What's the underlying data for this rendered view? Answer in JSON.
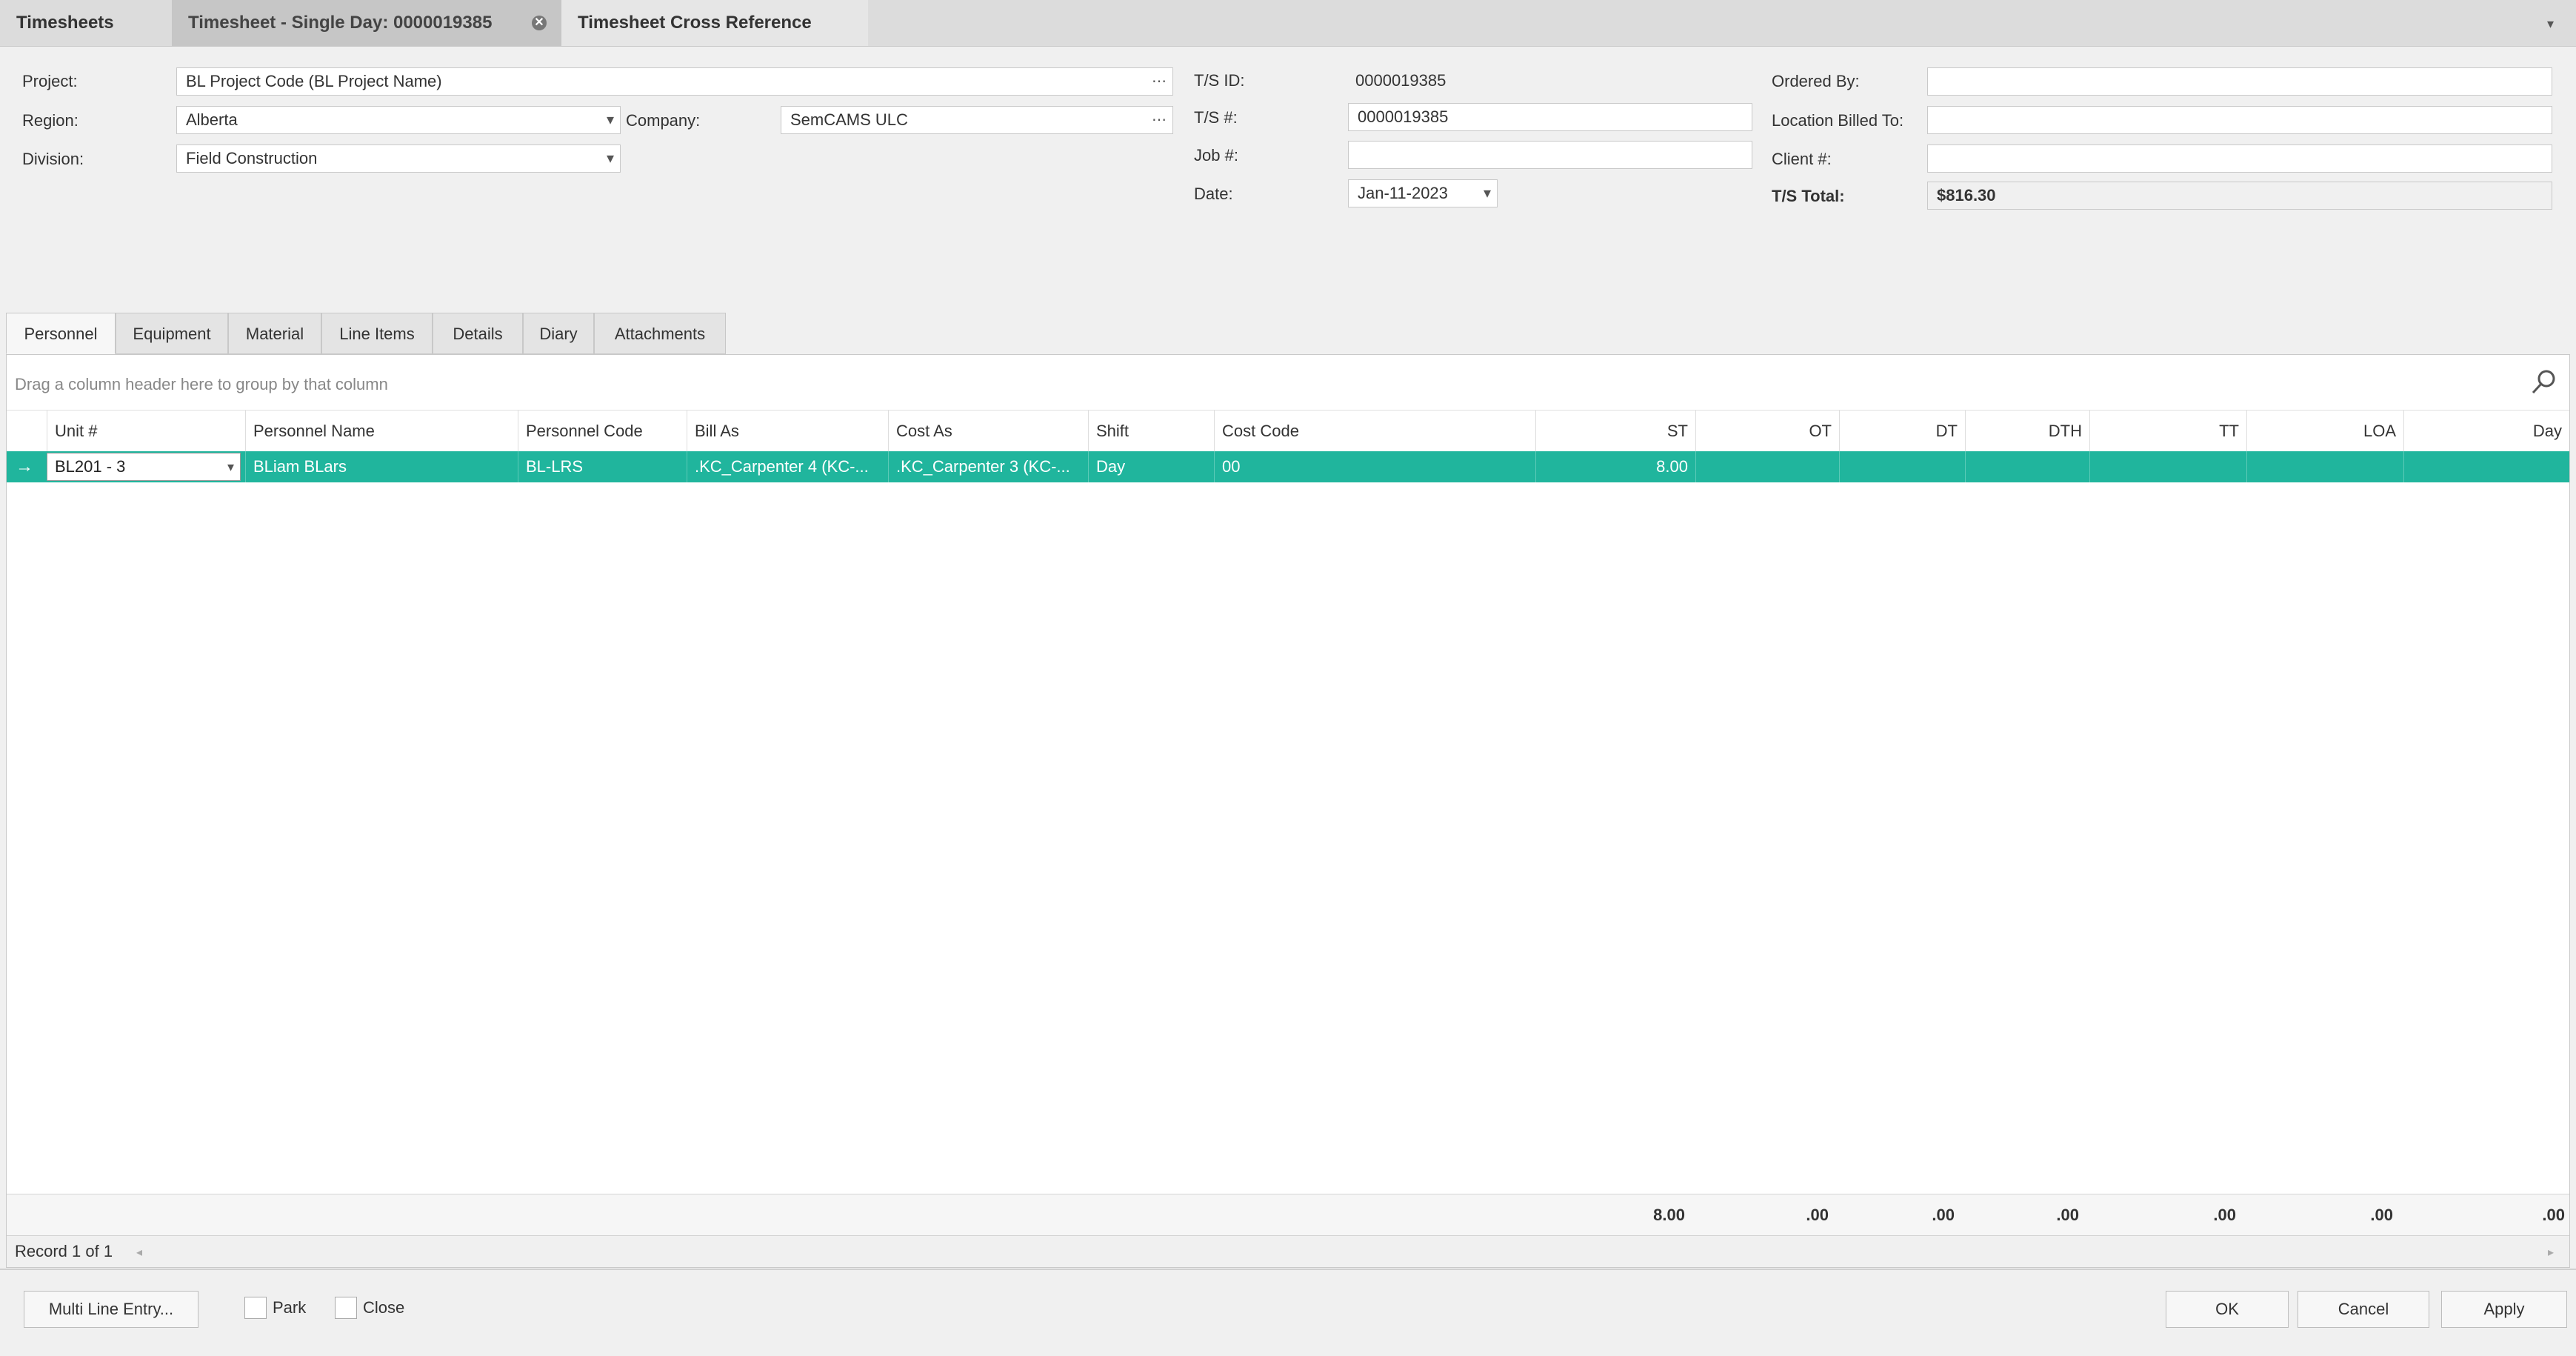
{
  "doc_tabs": [
    {
      "label": "Timesheets"
    },
    {
      "label": "Timesheet - Single Day: 0000019385"
    },
    {
      "label": "Timesheet Cross Reference"
    }
  ],
  "form": {
    "project_label": "Project:",
    "project_value": "BL Project Code (BL Project Name)",
    "region_label": "Region:",
    "region_value": "Alberta",
    "company_label": "Company:",
    "company_value": "SemCAMS ULC",
    "division_label": "Division:",
    "division_value": "Field Construction",
    "tsid_label": "T/S ID:",
    "tsid_value": "0000019385",
    "tsnum_label": "T/S #:",
    "tsnum_value": "0000019385",
    "job_label": "Job #:",
    "job_value": "",
    "date_label": "Date:",
    "date_value": "Jan-11-2023",
    "ordered_by_label": "Ordered By:",
    "ordered_by_value": "",
    "location_label": "Location Billed To:",
    "location_value": "",
    "client_label": "Client #:",
    "client_value": "",
    "total_label": "T/S Total:",
    "total_value": "$816.30"
  },
  "tabs": [
    "Personnel",
    "Equipment",
    "Material",
    "Line Items",
    "Details",
    "Diary",
    "Attachments"
  ],
  "grid": {
    "group_hint": "Drag a column header here to group by that column",
    "columns": [
      "Unit #",
      "Personnel Name",
      "Personnel Code",
      "Bill As",
      "Cost As",
      "Shift",
      "Cost Code",
      "ST",
      "OT",
      "DT",
      "DTH",
      "TT",
      "LOA",
      "Day"
    ],
    "rows": [
      [
        "BL201 - 3",
        "BLiam BLars",
        "BL-LRS",
        ".KC_Carpenter 4 (KC-...",
        ".KC_Carpenter 3 (KC-...",
        "Day",
        "00",
        "8.00",
        "",
        "",
        "",
        "",
        "",
        ""
      ]
    ],
    "totals": [
      "8.00",
      ".00",
      ".00",
      ".00",
      ".00",
      ".00",
      ".00"
    ],
    "record_text": "Record 1 of 1"
  },
  "bottom": {
    "multi_line": "Multi Line Entry...",
    "park": "Park",
    "close": "Close",
    "ok": "OK",
    "cancel": "Cancel",
    "apply": "Apply"
  },
  "colors": {
    "selected_row": "#20b59d"
  }
}
